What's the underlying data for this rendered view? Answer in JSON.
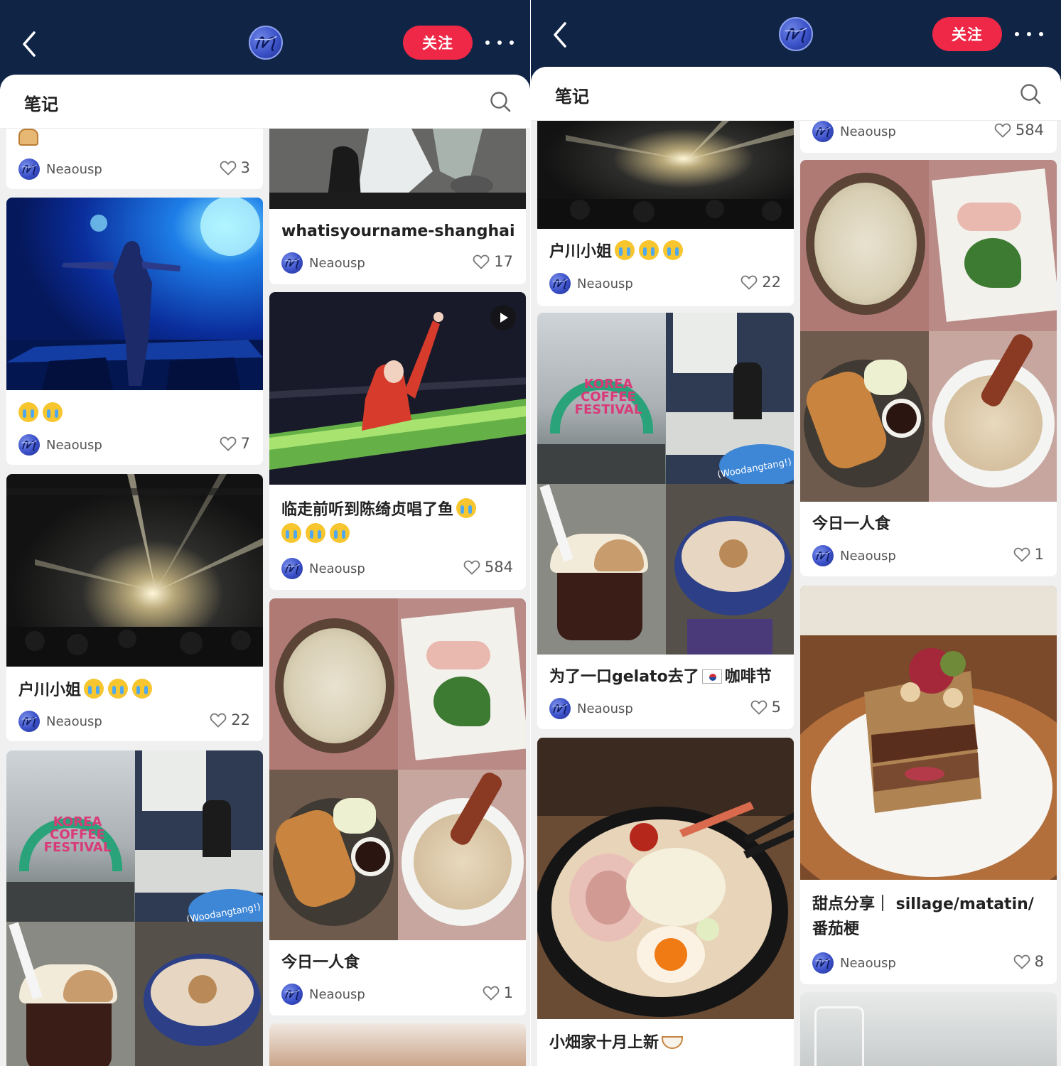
{
  "colors": {
    "header_bg": "#102546",
    "follow_red": "#ee2846"
  },
  "left": {
    "header": {
      "follow_label": "关注"
    },
    "sheet": {
      "title": "笔记"
    },
    "cards": [
      {
        "title": "",
        "author": "Neaousp",
        "likes": "3"
      },
      {
        "title": "",
        "author": "Neaousp",
        "likes": "7"
      },
      {
        "title": "户川小姐",
        "author": "Neaousp",
        "likes": "22"
      },
      {
        "title": "",
        "author": "",
        "likes": ""
      },
      {
        "title": "whatisyourname-shanghai",
        "author": "Neaousp",
        "likes": "17"
      },
      {
        "title_line1": "临走前听到陈绮贞唱了鱼",
        "author": "Neaousp",
        "likes": "584"
      },
      {
        "title": "今日一人食",
        "author": "Neaousp",
        "likes": "1"
      }
    ],
    "photo_text": {
      "korea_sign": "KOREA COFFEE FESTIVAL",
      "woodangtang": "(Woodangtang!)"
    }
  },
  "right": {
    "header": {
      "follow_label": "关注"
    },
    "sheet": {
      "title": "笔记"
    },
    "cards": [
      {
        "title": "户川小姐",
        "author": "Neaousp",
        "likes": "22"
      },
      {
        "title": "为了一口gelato去了",
        "title_tail": "咖啡节",
        "author": "Neaousp",
        "likes": "5"
      },
      {
        "title": "小畑家十月上新",
        "author": "",
        "likes": ""
      },
      {
        "title": "",
        "author": "Neaousp",
        "likes": "584"
      },
      {
        "title": "今日一人食",
        "author": "Neaousp",
        "likes": "1"
      },
      {
        "title_line1": "甜点分享｜ sillage/matatin/",
        "title_line2": "番茄梗",
        "author": "Neaousp",
        "likes": "8"
      }
    ],
    "photo_text": {
      "korea_sign": "KOREA COFFEE FESTIVAL",
      "woodangtang": "(Woodangtang!)"
    }
  },
  "icons": [
    "chevron-left-icon",
    "more-dots-icon",
    "search-icon",
    "heart-icon",
    "play-icon",
    "crying-emoji-icon",
    "bread-emoji-icon",
    "korea-flag-emoji-icon",
    "noodle-emoji-icon"
  ]
}
